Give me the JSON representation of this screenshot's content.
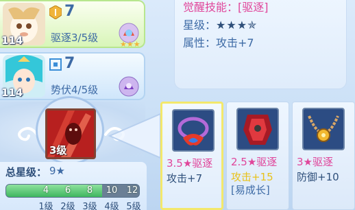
{
  "heroes": [
    {
      "level": "114",
      "type_icon": "attack-type-icon",
      "number": "7",
      "subtitle": "驱逐3/5级",
      "gem_icon": "gem-orb-icon",
      "stars_shown": 3
    },
    {
      "level": "114",
      "type_icon": "defense-type-icon",
      "number": "7",
      "subtitle": "势伏4/5级",
      "gem_icon": "gem-orb-icon"
    }
  ],
  "info": {
    "awaken_skill": "觉醒技能：[驱逐]",
    "star_label": "星级：",
    "stars": "★★★✯",
    "attr_label": "属性：",
    "attr_value": "攻击+7"
  },
  "skill": {
    "level": "3级"
  },
  "total": {
    "label": "总星级：",
    "value": "9★",
    "marks": [
      "4",
      "6",
      "8",
      "10",
      "12"
    ],
    "tiers": [
      "1级",
      "2级",
      "3级",
      "4级",
      "5级"
    ],
    "progress_fraction": 0.72
  },
  "cards": [
    {
      "tier": "3.5★驱逐",
      "stat": "攻击+7",
      "extra": "",
      "selected": true
    },
    {
      "tier": "2.5★驱逐",
      "stat": "攻击+15",
      "extra": "[易成长]",
      "selected": false
    },
    {
      "tier": "3★驱逐",
      "stat": "防御+10",
      "extra": "",
      "selected": false
    }
  ],
  "colors": {
    "accent_pink": "#e0459a",
    "accent_yellow": "#e8c21a",
    "selected_border": "#f3e86b",
    "bar_green": "#3fb65f"
  }
}
